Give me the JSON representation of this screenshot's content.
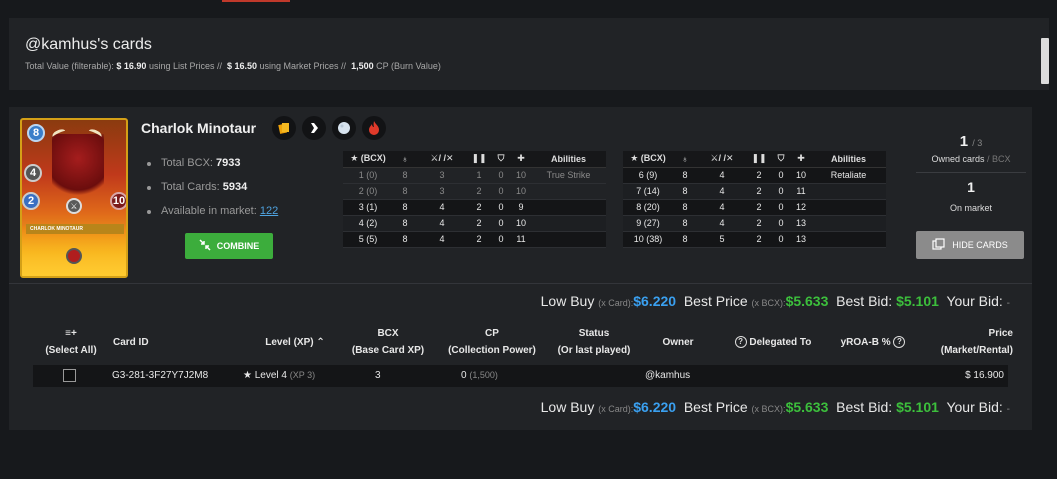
{
  "header": {
    "title": "@kamhus's cards",
    "total_value_label": "Total Value (filterable):",
    "list_value": "$ 16.90",
    "list_suffix": "using List Prices //",
    "market_value": "$ 16.50",
    "market_suffix": "using Market Prices //",
    "cp_value": "1,500",
    "cp_suffix": "CP (Burn Value)"
  },
  "card": {
    "name": "Charlok Minotaur",
    "art_name": "CHARLOK MINOTAUR",
    "mana": "8",
    "speed": "4",
    "magic": "2",
    "health": "10",
    "ability_icons": [
      "gold-foil-icon",
      "editon-icon",
      "moon-icon",
      "fire-element-icon"
    ],
    "total_bcx_label": "Total BCX:",
    "total_bcx": "7933",
    "total_cards_label": "Total Cards:",
    "total_cards": "5934",
    "available_label": "Available in market:",
    "available": "122",
    "combine_label": "COMBINE",
    "owned_count": "1",
    "owned_total": "/ 3",
    "owned_label": "Owned cards",
    "owned_unit": "/ BCX",
    "market_count": "1",
    "market_label": "On market",
    "hide_label": "HIDE CARDS"
  },
  "stats_headers": [
    "(BCX)",
    "",
    "/ /",
    "",
    "",
    "",
    "Abilities"
  ],
  "stats_left": [
    {
      "lvl": "1 (0)",
      "mana": "8",
      "atk": "3",
      "spd": "1",
      "arm": "0",
      "hp": "10",
      "abil": "True Strike"
    },
    {
      "lvl": "2 (0)",
      "mana": "8",
      "atk": "3",
      "spd": "2",
      "arm": "0",
      "hp": "10",
      "abil": ""
    },
    {
      "lvl": "3 (1)",
      "mana": "8",
      "atk": "4",
      "spd": "2",
      "arm": "0",
      "hp": "9",
      "abil": ""
    },
    {
      "lvl": "4 (2)",
      "mana": "8",
      "atk": "4",
      "spd": "2",
      "arm": "0",
      "hp": "10",
      "abil": ""
    },
    {
      "lvl": "5 (5)",
      "mana": "8",
      "atk": "4",
      "spd": "2",
      "arm": "0",
      "hp": "11",
      "abil": ""
    }
  ],
  "stats_right": [
    {
      "lvl": "6 (9)",
      "mana": "8",
      "atk": "4",
      "spd": "2",
      "arm": "0",
      "hp": "10",
      "abil": "Retaliate"
    },
    {
      "lvl": "7 (14)",
      "mana": "8",
      "atk": "4",
      "spd": "2",
      "arm": "0",
      "hp": "11",
      "abil": ""
    },
    {
      "lvl": "8 (20)",
      "mana": "8",
      "atk": "4",
      "spd": "2",
      "arm": "0",
      "hp": "12",
      "abil": ""
    },
    {
      "lvl": "9 (27)",
      "mana": "8",
      "atk": "4",
      "spd": "2",
      "arm": "0",
      "hp": "13",
      "abil": ""
    },
    {
      "lvl": "10 (38)",
      "mana": "8",
      "atk": "5",
      "spd": "2",
      "arm": "0",
      "hp": "13",
      "abil": ""
    }
  ],
  "prices": {
    "low_buy_label": "Low Buy",
    "low_buy_unit": "(x Card):",
    "low_buy": "$6.220",
    "best_price_label": "Best Price",
    "best_price_unit": "(x BCX):",
    "best_price": "$5.633",
    "best_bid_label": "Best Bid:",
    "best_bid": "$5.101",
    "your_bid_label": "Your Bid:",
    "your_bid": "-"
  },
  "list": {
    "col_select_icon": "≡+",
    "col_select": "(Select All)",
    "col_card_id": "Card ID",
    "col_level": "Level (XP)",
    "col_bcx": "BCX",
    "col_bcx_sub": "(Base Card XP)",
    "col_cp": "CP",
    "col_cp_sub": "(Collection Power)",
    "col_status": "Status",
    "col_status_sub": "(Or last played)",
    "col_owner": "Owner",
    "col_delegated": "Delegated To",
    "col_yroa": "yROA-B %",
    "col_price": "Price",
    "col_price_sub": "(Market/Rental)",
    "row": {
      "card_id": "G3-281-3F27Y7J2M8",
      "level": "Level 4",
      "xp": "(XP 3)",
      "bcx": "3",
      "cp": "0",
      "cp_sub": "(1,500)",
      "owner": "@kamhus",
      "price": "$ 16.900"
    }
  }
}
